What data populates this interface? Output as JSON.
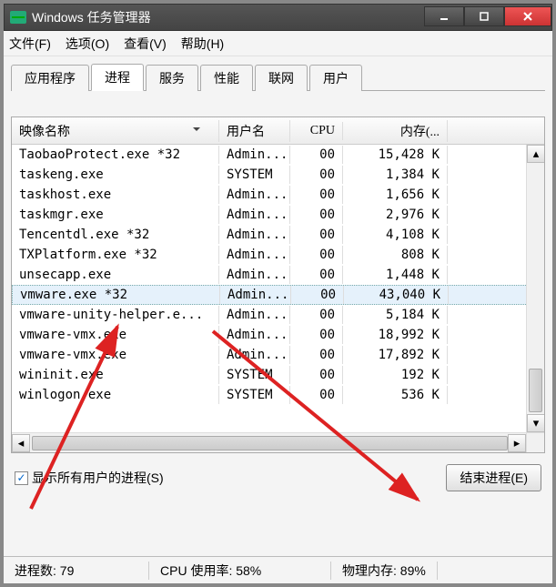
{
  "window": {
    "title": "Windows 任务管理器"
  },
  "window_controls": {
    "min": "min",
    "max": "max",
    "close": "close"
  },
  "menu": {
    "file": "文件(F)",
    "options": "选项(O)",
    "view": "查看(V)",
    "help": "帮助(H)"
  },
  "tabs": {
    "apps": "应用程序",
    "processes": "进程",
    "services": "服务",
    "performance": "性能",
    "networking": "联网",
    "users": "用户"
  },
  "columns": {
    "name": "映像名称",
    "user": "用户名",
    "cpu": "CPU",
    "mem": "内存(..."
  },
  "rows": [
    {
      "name": "TaobaoProtect.exe *32",
      "user": "Admin...",
      "cpu": "00",
      "mem": "15,428 K"
    },
    {
      "name": "taskeng.exe",
      "user": "SYSTEM",
      "cpu": "00",
      "mem": "1,384 K"
    },
    {
      "name": "taskhost.exe",
      "user": "Admin...",
      "cpu": "00",
      "mem": "1,656 K"
    },
    {
      "name": "taskmgr.exe",
      "user": "Admin...",
      "cpu": "00",
      "mem": "2,976 K"
    },
    {
      "name": "Tencentdl.exe *32",
      "user": "Admin...",
      "cpu": "00",
      "mem": "4,108 K"
    },
    {
      "name": "TXPlatform.exe *32",
      "user": "Admin...",
      "cpu": "00",
      "mem": "808 K"
    },
    {
      "name": "unsecapp.exe",
      "user": "Admin...",
      "cpu": "00",
      "mem": "1,448 K"
    },
    {
      "name": "vmware.exe *32",
      "user": "Admin...",
      "cpu": "00",
      "mem": "43,040 K",
      "selected": true
    },
    {
      "name": "vmware-unity-helper.e...",
      "user": "Admin...",
      "cpu": "00",
      "mem": "5,184 K"
    },
    {
      "name": "vmware-vmx.exe",
      "user": "Admin...",
      "cpu": "00",
      "mem": "18,992 K"
    },
    {
      "name": "vmware-vmx.exe",
      "user": "Admin...",
      "cpu": "00",
      "mem": "17,892 K"
    },
    {
      "name": "wininit.exe",
      "user": "SYSTEM",
      "cpu": "00",
      "mem": "192 K"
    },
    {
      "name": "winlogon.exe",
      "user": "SYSTEM",
      "cpu": "00",
      "mem": "536 K"
    }
  ],
  "show_all_users": {
    "label": "显示所有用户的进程(S)",
    "checked": true
  },
  "end_process_button": "结束进程(E)",
  "status": {
    "process_count": "进程数: 79",
    "cpu_usage": "CPU 使用率: 58%",
    "physical_memory": "物理内存: 89%"
  }
}
